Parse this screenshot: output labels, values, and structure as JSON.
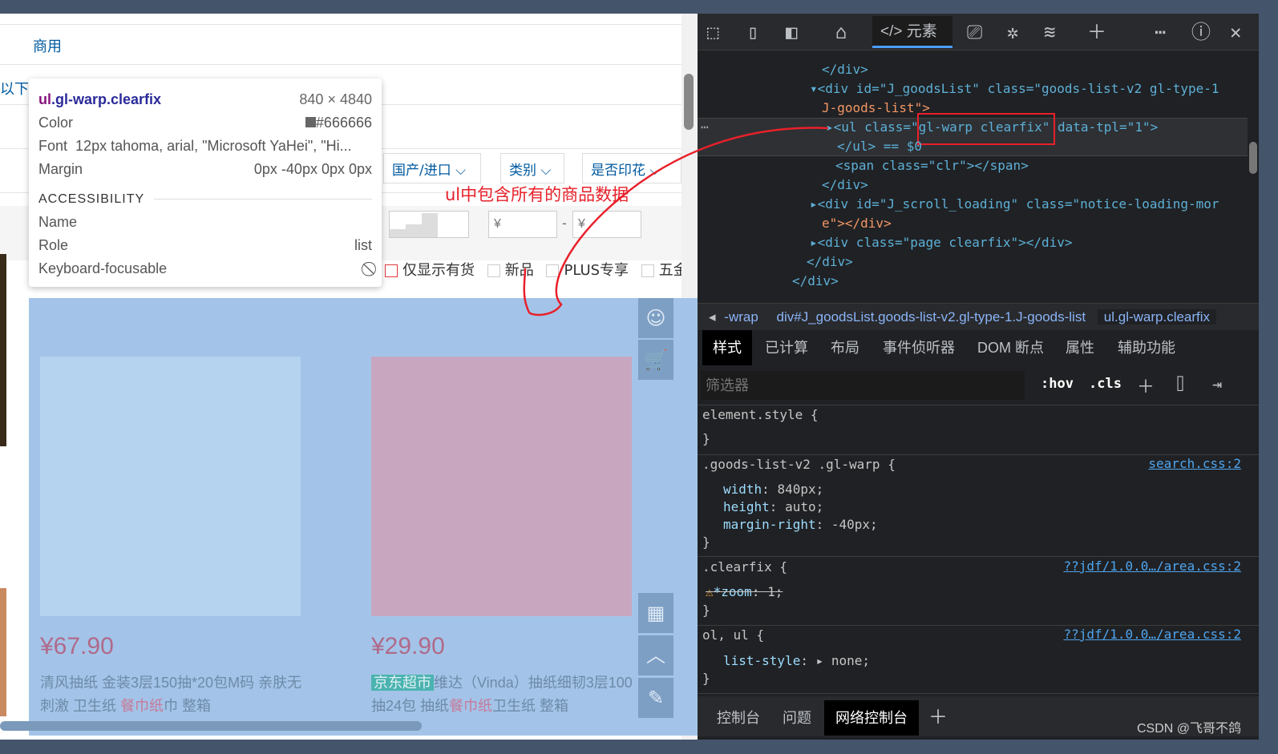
{
  "page": {
    "category_link": "商用",
    "partial_text": "以下",
    "filters": [
      "国产/进口",
      "类别",
      "是否印花"
    ],
    "price_from_placeholder": "¥",
    "price_to_placeholder": "¥",
    "price_dash": "-",
    "checkboxes": [
      "仅显示有货",
      "新品",
      "PLUS专享",
      "五金"
    ],
    "annotation": "ul中包含所有的商品数据",
    "products": [
      {
        "price": "¥67.90",
        "badge": "",
        "title_a": "清风抽纸 金装3层150抽*20包M码 亲肤无刺激 卫生纸 ",
        "title_hl": "餐巾纸",
        "title_b": "巾 整箱"
      },
      {
        "price": "¥29.90",
        "badge": "京东超市",
        "title_a": "维达（Vinda）抽纸细韧3层100抽24包 抽纸",
        "title_hl": "餐巾纸",
        "title_b": "卫生纸 整箱"
      }
    ],
    "sidebar_icons": [
      "user-icon",
      "cart-icon",
      "qrcode-icon",
      "back-to-top-icon",
      "feedback-icon"
    ]
  },
  "tooltip": {
    "selector_tag": "ul",
    "selector_class": ".gl-warp.clearfix",
    "size": "840 × 4840",
    "color_label": "Color",
    "color_value": "#666666",
    "font_label": "Font",
    "font_value": "12px tahoma, arial, \"Microsoft YaHei\", \"Hi...",
    "margin_label": "Margin",
    "margin_value": "0px -40px 0px 0px",
    "accessibility": "ACCESSIBILITY",
    "name_label": "Name",
    "role_label": "Role",
    "role_value": "list",
    "focus_label": "Keyboard-focusable"
  },
  "devtools": {
    "elements_tab": "元素",
    "dom": [
      "</div>",
      "<div id=\"J_goodsList\" class=\"goods-list-v2 gl-type-1",
      "J-goods-list\">",
      "<ul class=\"gl-warp clearfix\" data-tpl=\"1\">",
      "</ul> == $0",
      "<span class=\"clr\"></span>",
      "</div>",
      "<div id=\"J_scroll_loading\" class=\"notice-loading-mor",
      "e\"></div>",
      "<div class=\"page clearfix\"></div>",
      "</div>",
      "</div>"
    ],
    "breadcrumbs": [
      "-wrap",
      "div#J_goodsList.goods-list-v2.gl-type-1.J-goods-list",
      "ul.gl-warp.clearfix"
    ],
    "panel_tabs": [
      "样式",
      "已计算",
      "布局",
      "事件侦听器",
      "DOM 断点",
      "属性",
      "辅助功能"
    ],
    "filter_placeholder": "筛选器",
    "hov": ":hov",
    "cls": ".cls",
    "rules": [
      {
        "selector": "element.style {",
        "source": "",
        "decls": []
      },
      {
        "selector": ".goods-list-v2 .gl-warp {",
        "source": "search.css:2",
        "decls": [
          [
            "width",
            "840px"
          ],
          [
            "height",
            "auto"
          ],
          [
            "margin-right",
            "-40px"
          ]
        ]
      },
      {
        "selector": ".clearfix {",
        "source": "??jdf/1.0.0…/area.css:2",
        "decls": [
          [
            "*zoom",
            "1"
          ]
        ]
      },
      {
        "selector": "ol, ul {",
        "source": "??jdf/1.0.0…/area.css:2",
        "decls": [
          [
            "list-style",
            "none"
          ]
        ]
      }
    ],
    "drawer_tabs": [
      "控制台",
      "问题",
      "网络控制台"
    ],
    "watermark": "CSDN @飞哥不鸽"
  },
  "colors": {
    "highlight": "#a3c4e8",
    "annotation": "#e8202a",
    "devtools_bg": "#202124"
  }
}
